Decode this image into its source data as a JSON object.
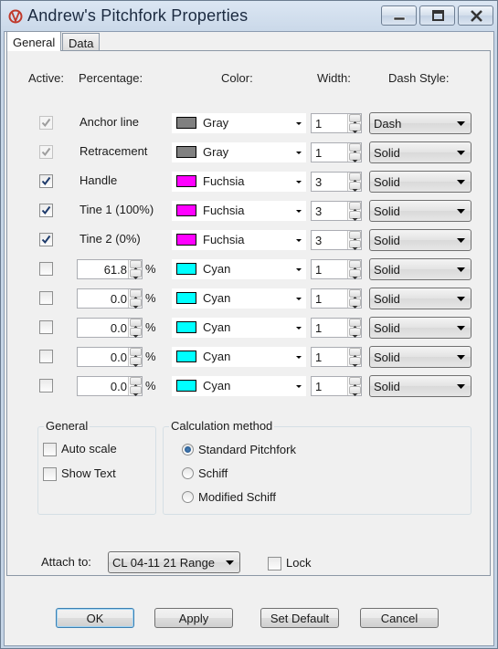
{
  "window": {
    "title": "Andrew's Pitchfork Properties"
  },
  "tabs": [
    {
      "label": "General"
    },
    {
      "label": "Data"
    }
  ],
  "headers": {
    "active": "Active:",
    "percentage": "Percentage:",
    "color": "Color:",
    "width": "Width:",
    "dash_style": "Dash Style:"
  },
  "rows": [
    {
      "checked": true,
      "disabled": true,
      "label": "Anchor line",
      "color_name": "Gray",
      "color_hex": "#808080",
      "width": "1",
      "dash": "Dash"
    },
    {
      "checked": true,
      "disabled": true,
      "label": "Retracement",
      "color_name": "Gray",
      "color_hex": "#808080",
      "width": "1",
      "dash": "Solid"
    },
    {
      "checked": true,
      "disabled": false,
      "label": "Handle",
      "color_name": "Fuchsia",
      "color_hex": "#ff00ff",
      "width": "3",
      "dash": "Solid"
    },
    {
      "checked": true,
      "disabled": false,
      "label": "Tine 1 (100%)",
      "color_name": "Fuchsia",
      "color_hex": "#ff00ff",
      "width": "3",
      "dash": "Solid"
    },
    {
      "checked": true,
      "disabled": false,
      "label": "Tine 2 (0%)",
      "color_name": "Fuchsia",
      "color_hex": "#ff00ff",
      "width": "3",
      "dash": "Solid"
    },
    {
      "checked": false,
      "disabled": false,
      "pct": "61.8",
      "pct_sign": "%",
      "color_name": "Cyan",
      "color_hex": "#00ffff",
      "width": "1",
      "dash": "Solid"
    },
    {
      "checked": false,
      "disabled": false,
      "pct": "0.0",
      "pct_sign": "%",
      "color_name": "Cyan",
      "color_hex": "#00ffff",
      "width": "1",
      "dash": "Solid"
    },
    {
      "checked": false,
      "disabled": false,
      "pct": "0.0",
      "pct_sign": "%",
      "color_name": "Cyan",
      "color_hex": "#00ffff",
      "width": "1",
      "dash": "Solid"
    },
    {
      "checked": false,
      "disabled": false,
      "pct": "0.0",
      "pct_sign": "%",
      "color_name": "Cyan",
      "color_hex": "#00ffff",
      "width": "1",
      "dash": "Solid"
    },
    {
      "checked": false,
      "disabled": false,
      "pct": "0.0",
      "pct_sign": "%",
      "color_name": "Cyan",
      "color_hex": "#00ffff",
      "width": "1",
      "dash": "Solid"
    }
  ],
  "general_group": {
    "title": "General",
    "auto_scale": "Auto scale",
    "show_text": "Show Text"
  },
  "calc_group": {
    "title": "Calculation method",
    "options": [
      "Standard Pitchfork",
      "Schiff",
      "Modified Schiff"
    ],
    "selected": "Standard Pitchfork"
  },
  "attach": {
    "label": "Attach to:",
    "value": "CL 04-11 21 Range",
    "lock": "Lock"
  },
  "buttons": {
    "ok": "OK",
    "apply": "Apply",
    "set_default": "Set Default",
    "cancel": "Cancel"
  }
}
